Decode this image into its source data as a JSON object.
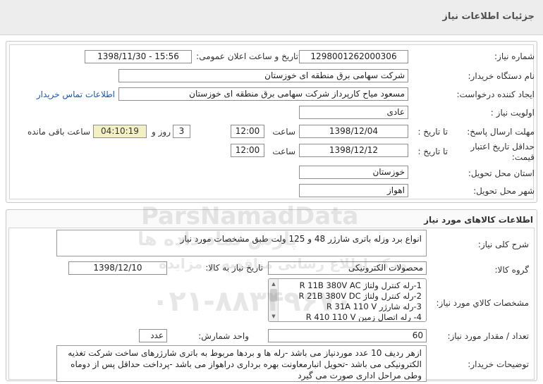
{
  "header": {
    "title": "جزئیات اطلاعات نیاز"
  },
  "need_info": {
    "need_number": {
      "label": "شماره نیاز:",
      "value": "1298001262000306"
    },
    "announce_datetime": {
      "label": "تاریخ و ساعت اعلان عمومی:",
      "value": "1398/11/30 - 15:56"
    },
    "buyer_org": {
      "label": "نام دستگاه خریدار:",
      "value": "شرکت سهامی برق منطقه ای خوزستان"
    },
    "requester": {
      "label": "ایجاد کننده درخواست:",
      "value": "مسعود میاح کارپرداز شرکت سهامی برق منطقه ای خوزستان",
      "contact_link": "اطلاعات تماس خریدار"
    },
    "priority": {
      "label": "اولویت نیاز :",
      "value": "عادی"
    },
    "response_deadline": {
      "label": "مهلت ارسال پاسخ:",
      "to_date_label": "تا تاریخ :",
      "date": "1398/12/04",
      "time_label": "ساعت",
      "time": "12:00",
      "days": "3",
      "days_label": "روز و",
      "remaining": "04:10:19",
      "remaining_label": "ساعت باقی مانده"
    },
    "price_validity": {
      "label": "حداقل تاریخ اعتبار قیمت:",
      "to_date_label": "تا تاریخ :",
      "date": "1398/12/12",
      "time_label": "ساعت",
      "time": "12:00"
    },
    "delivery_province": {
      "label": "استان محل تحویل:",
      "value": "خوزستان"
    },
    "delivery_city": {
      "label": "شهر محل تحویل:",
      "value": "اهواز"
    }
  },
  "goods": {
    "section_title": "اطلاعات کالاهای مورد نیاز",
    "description": {
      "label": "شرح کلی نیاز:",
      "value": "انواع برد وزله باتری شارژر 48 و 125 ولت طبق مشخصات مورد نیاز"
    },
    "group": {
      "label": "گروه کالا:",
      "value": "محصولات الکترونیکی",
      "need_date_label": "تاریخ نیاز به کالا:",
      "need_date": "1398/12/10"
    },
    "specs": {
      "label": "مشخصات کالاي مورد نياز:",
      "items": [
        "1-رله کنترل ولتاژ R 11B 380V AC",
        "2-رله کنترل ولتاژ R 21B 380V DC",
        "3-رله شارژر R 31A 110 V",
        "4- رله اتصال زمین R 410 110 V"
      ]
    },
    "quantity": {
      "label": "تعداد / مقدار مورد نیاز:",
      "value": "60",
      "unit_label": "واحد شمارش:",
      "unit": "عدد"
    },
    "buyer_notes": {
      "label": "توضیحات خریدار:",
      "lines": [
        "ازهر ردیف 10 عدد موردنیاز می باشد -رله ها و بردها مربوط به باتری شارژرهای ساخت شرکت تغذیه",
        "الکترونیکی می باشد -تحویل انبارمعاونت بهره برداری دراهواز می باشد -پرداخت حداقل پس از دوماه",
        "وطی مراحل اداری صورت می گیرد"
      ]
    }
  },
  "watermark": {
    "brand": "ParsNamadData",
    "brand_fa": "پارس نماد داده ها",
    "tagline": "مرکز اطلاع رسانی مناقصه و مزایده",
    "phone": "۰۲۱-۸۸۳۴۹۶۷۰"
  },
  "colors": {
    "link": "#1a56c4",
    "remaining_bg": "#f3f0c3",
    "title_text": "#505050"
  }
}
